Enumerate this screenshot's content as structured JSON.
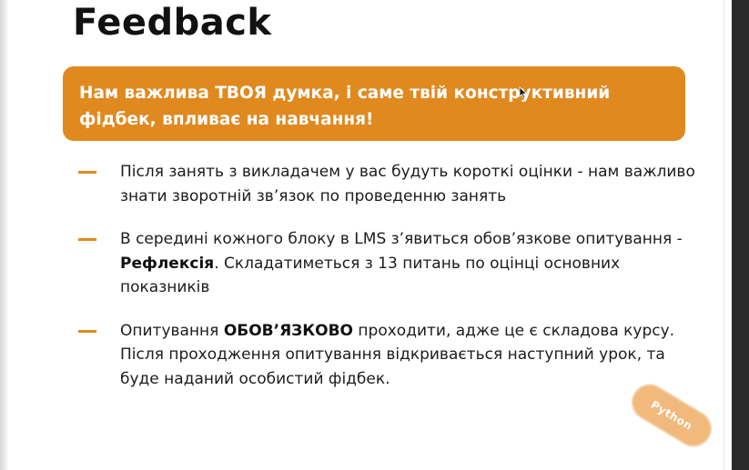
{
  "slide": {
    "title": "Feedback",
    "banner": "Нам важлива ТВОЯ думка, і саме твій конструктивний фідбек, впливає на навчання!",
    "bullets": [
      {
        "before": "Після занять з викладачем у вас будуть короткі оцінки - нам важливо знати зворотній зв’язок по проведенню занять",
        "bold": "",
        "after": ""
      },
      {
        "before": "В середині кожного блоку в LMS з’явиться обов’язкове опитування - ",
        "bold": "Рефлексія",
        "after": ". Складатиметься з 13 питань по оцінці основних показників"
      },
      {
        "before": "Опитування ",
        "bold": "ОБОВ’ЯЗКОВО",
        "after": " проходити, адже це є складова курсу. Після проходження опитування відкривається наступний урок, та буде наданий особистий фідбек."
      }
    ],
    "badge": "Python"
  },
  "colors": {
    "accent": "#e0891f",
    "badge": "#f2b97c",
    "text": "#1c1c1c"
  },
  "icons": {
    "cursor": "mouse-pointer-icon"
  }
}
